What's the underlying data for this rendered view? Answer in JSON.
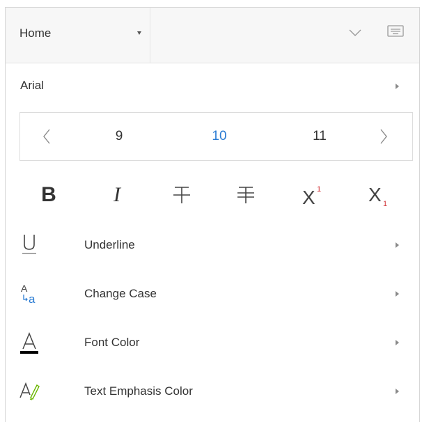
{
  "header": {
    "tab_label": "Home"
  },
  "font": {
    "name": "Arial"
  },
  "size_picker": {
    "sizes": [
      "9",
      "10",
      "11"
    ],
    "selected": "10"
  },
  "formatting": {
    "bold": "B",
    "italic": "I"
  },
  "items": [
    {
      "label": "Underline",
      "icon": "underline-icon"
    },
    {
      "label": "Change Case",
      "icon": "change-case-icon"
    },
    {
      "label": "Font Color",
      "icon": "font-color-icon"
    },
    {
      "label": "Text Emphasis Color",
      "icon": "text-emphasis-color-icon"
    }
  ],
  "colors": {
    "accent": "#2b7cd3",
    "superscript_digit": "#d13438",
    "change_case_accent": "#2b7cd3",
    "font_color_bar": "#000000",
    "highlighter_green": "#6bb700"
  }
}
